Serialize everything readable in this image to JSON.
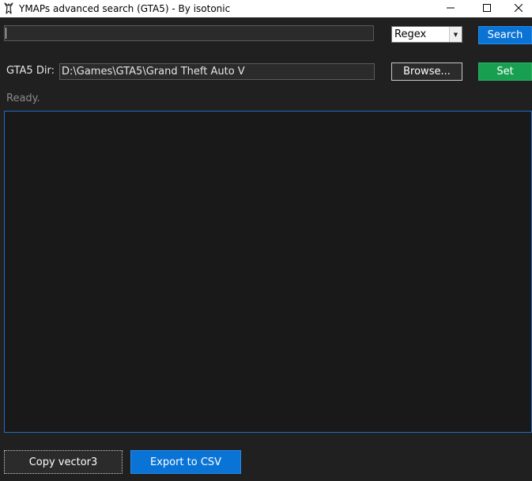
{
  "window": {
    "title": "YMAPs advanced search (GTA5) - By isotonic",
    "icon": "gta-logo-icon"
  },
  "search": {
    "value": "",
    "mode": "Regex",
    "button_label": "Search"
  },
  "directory": {
    "label": "GTA5 Dir:",
    "value": "D:\\Games\\GTA5\\Grand Theft Auto V",
    "browse_label": "Browse...",
    "set_label": "Set"
  },
  "status": {
    "text": "Ready."
  },
  "actions": {
    "copy_label": "Copy vector3",
    "export_label": "Export to CSV"
  },
  "colors": {
    "background": "#202020",
    "accent_blue": "#0a74d6",
    "accent_green": "#18a050",
    "results_border": "#1f6fc4"
  }
}
